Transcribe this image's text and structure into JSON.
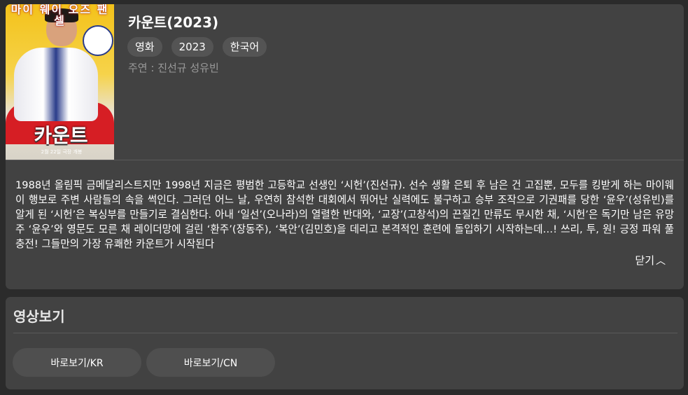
{
  "movie": {
    "poster_title": "카운트",
    "poster_tagline": "마이 웨이 오즈 팬셀",
    "poster_release": "2월 22일 극장 개봉",
    "title": "카운트(2023)",
    "tags": [
      "영화",
      "2023",
      "한국어"
    ],
    "cast": "주연 : 진선규 성유빈",
    "synopsis": "1988년 올림픽 금메달리스트지만 1998년 지금은 평범한 고등학교 선생인 ‘시헌’(진선규). 선수 생활 은퇴 후 남은 건 고집뿐, 모두를 킹받게 하는 마이웨이 행보로 주변 사람들의 속을 썩인다. 그러던 어느 날, 우연히 참석한 대회에서 뛰어난 실력에도 불구하고 승부 조작으로 기권패를 당한 ‘윤우’(성유빈)를 알게 된 ‘시헌’은 복싱부를 만들기로 결심한다. 아내 ‘일선’(오나라)의 열렬한 반대와, ‘교장’(고창석)의 끈질긴 만류도 무시한 채, ‘시헌’은 독기만 남은 유망주 ‘윤우’와 영문도 모른 채 레이더망에 걸린 ‘환주’(장동주), ‘복안’(김민호)을 데리고 본격적인 훈련에 돌입하기 시작하는데…! 쓰리, 투, 원! 긍정 파워 풀충전! 그들만의 가장 유쾌한 카운트가 시작된다",
    "close_label": "닫기"
  },
  "icons": {
    "close": "chevron-up-icon"
  },
  "video": {
    "section_title": "영상보기",
    "buttons": [
      "바로보기/KR",
      "바로보기/CN"
    ]
  },
  "colors": {
    "background": "#2b2b2b",
    "card": "#424242",
    "chip": "#545454",
    "button": "#4f4f4f",
    "muted_text": "#9a9a9a"
  }
}
